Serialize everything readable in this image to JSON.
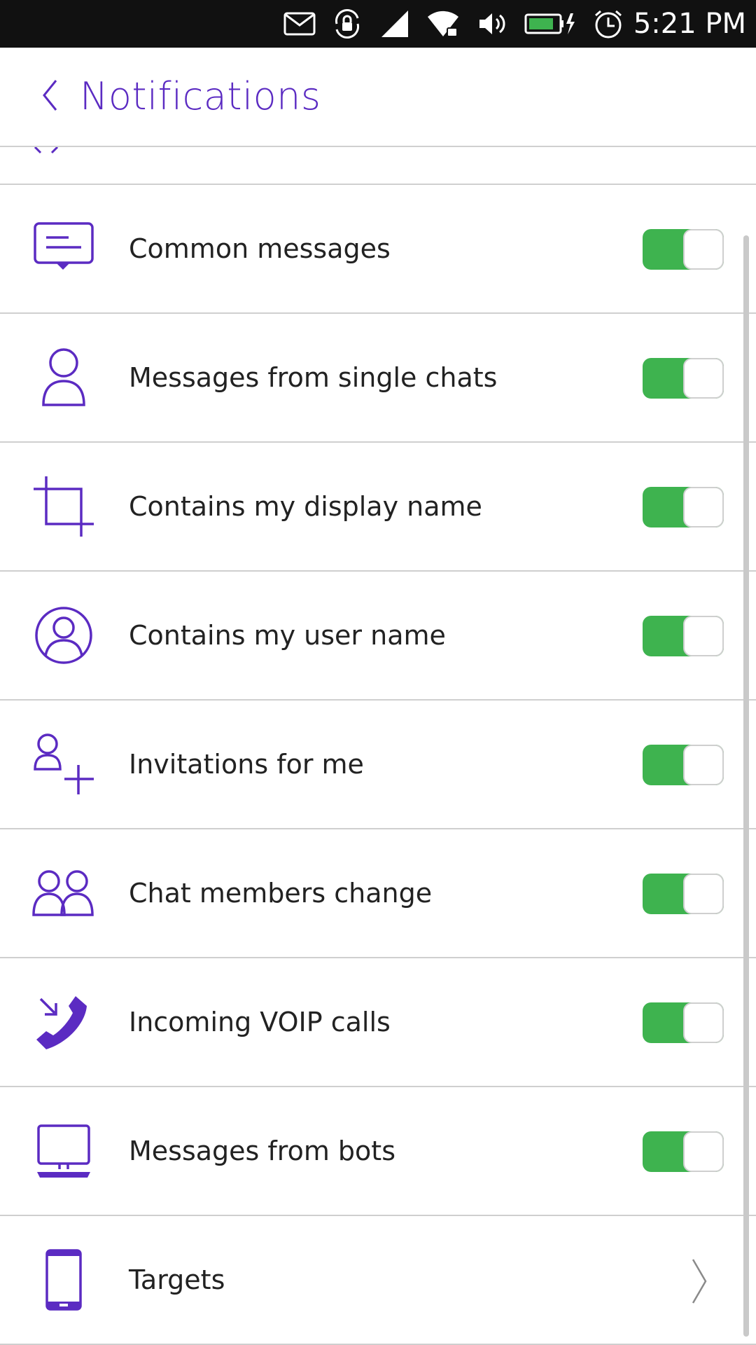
{
  "status_bar": {
    "time": "5:21 PM",
    "icons": [
      "mail-icon",
      "rotation-lock-icon",
      "cellular-signal-icon",
      "wifi-icon",
      "volume-icon",
      "battery-charging-icon",
      "alarm-icon"
    ]
  },
  "header": {
    "title": "Notifications",
    "back_icon": "chevron-left-icon"
  },
  "settings": [
    {
      "label": "Common messages",
      "icon": "message-icon",
      "enabled": true
    },
    {
      "label": "Messages from single chats",
      "icon": "person-icon",
      "enabled": true
    },
    {
      "label": "Contains my display name",
      "icon": "crop-icon",
      "enabled": true
    },
    {
      "label": "Contains my user name",
      "icon": "account-circle-icon",
      "enabled": true
    },
    {
      "label": "Invitations for me",
      "icon": "add-contact-icon",
      "enabled": true
    },
    {
      "label": "Chat members change",
      "icon": "group-icon",
      "enabled": true
    },
    {
      "label": "Incoming VOIP calls",
      "icon": "incoming-call-icon",
      "enabled": true
    },
    {
      "label": "Messages from bots",
      "icon": "computer-icon",
      "enabled": true
    },
    {
      "label": "Targets",
      "icon": "phone-device-icon",
      "chevron": "chevron-right-icon"
    }
  ],
  "colors": {
    "accent": "#5b2bc2",
    "toggle_on": "#3eb34f",
    "divider": "#cfcfcf",
    "status_bar_bg": "#111111"
  }
}
